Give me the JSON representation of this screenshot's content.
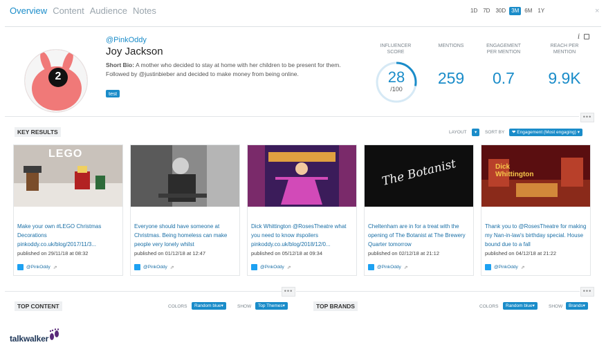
{
  "nav": {
    "tabs": [
      "Overview",
      "Content",
      "Audience",
      "Notes"
    ],
    "active_tab": 0,
    "ranges": [
      "1D",
      "7D",
      "30D",
      "3M",
      "6M",
      "1Y"
    ],
    "active_range": 3,
    "close": "×"
  },
  "profile": {
    "handle": "@PinkOddy",
    "name": "Joy Jackson",
    "bio_label": "Short Bio:",
    "bio_text": "A mother who decided to stay at home with her children to be present for them. Followed by @justinbieber and decided to make money from being online.",
    "tag": "test",
    "avatar_badge": "2"
  },
  "stats": {
    "influencer_label": "INFLUENCER SCORE",
    "influencer_score": "28",
    "influencer_max": "/100",
    "influencer_fraction": 0.28,
    "mentions_label": "MENTIONS",
    "mentions": "259",
    "engagement_label": "ENGAGEMENT PER MENTION",
    "engagement": "0.7",
    "reach_label": "REACH PER MENTION",
    "reach": "9.9K",
    "info_icon": "i"
  },
  "key_results": {
    "title": "KEY RESULTS",
    "layout_label": "LAYOUT",
    "sort_label": "SORT BY",
    "sort_value": "Engagement (Most engaging)",
    "cards": [
      {
        "caption": "Make your own #LEGO Christmas Decorations pinkoddy.co.uk/blog/2017/11/3...",
        "published": "published on 29/11/18 at 08:32",
        "author": "@PinkOddy",
        "thumb_text": "LEGO"
      },
      {
        "caption": "Everyone should have someone at Christmas. Being homeless can make people very lonely whilst",
        "published": "published on 01/12/18 at 12:47",
        "author": "@PinkOddy",
        "thumb_text": ""
      },
      {
        "caption": "Dick Whittington @RosesTheatre what you need to know #spoilers pinkoddy.co.uk/blog/2018/12/0...",
        "published": "published on 05/12/18 at 09:34",
        "author": "@PinkOddy",
        "thumb_text": ""
      },
      {
        "caption": "Cheltenham are in for a treat with the opening of The Botanist at The Brewery Quarter tomorrow",
        "published": "published on 02/12/18 at 21:12",
        "author": "@PinkOddy",
        "thumb_text": "The Botanist"
      },
      {
        "caption": "Thank you to @RosesTheatre for making my Nan-in-law's birthday special. House bound due to a fall",
        "published": "published on 04/12/18 at 21:22",
        "author": "@PinkOddy",
        "thumb_text": "Dick Whittington"
      }
    ]
  },
  "top_content": {
    "title": "TOP CONTENT",
    "colors_label": "COLORS",
    "colors_value": "Random blue",
    "show_label": "SHOW",
    "show_value": "Top Themes"
  },
  "top_brands": {
    "title": "TOP BRANDS",
    "colors_label": "COLORS",
    "colors_value": "Random blue",
    "show_label": "SHOW",
    "show_value": "Brands"
  },
  "brand": "talkwalker",
  "more": "•••",
  "ext_icon": "⇗",
  "colors": {
    "accent": "#1a8cc9",
    "twitter": "#1da1f2"
  }
}
